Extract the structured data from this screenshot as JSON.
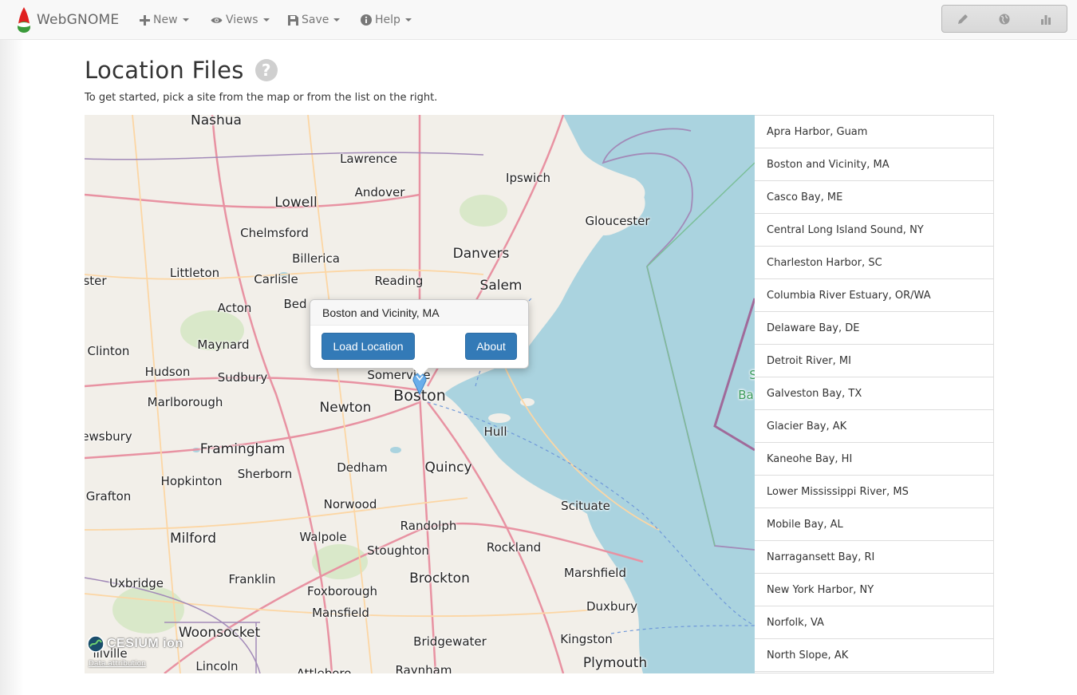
{
  "navbar": {
    "brand": "WebGNOME",
    "menus": [
      {
        "label": "New",
        "icon": "plus-icon"
      },
      {
        "label": "Views",
        "icon": "eye-icon"
      },
      {
        "label": "Save",
        "icon": "save-icon"
      },
      {
        "label": "Help",
        "icon": "info-circle-icon"
      }
    ],
    "tools": [
      "pencil-icon",
      "globe-icon",
      "bar-chart-icon"
    ]
  },
  "page": {
    "title": "Location Files",
    "intro": "To get started, pick a site from the map or from the list on the right."
  },
  "map": {
    "places": [
      "Nashua",
      "Lawrence",
      "Ipswich",
      "Andover",
      "Lowell",
      "Gloucester",
      "Chelmsford",
      "Danvers",
      "Billerica",
      "Salem",
      "Littleton",
      "Carlisle",
      "Reading",
      "ster",
      "Acton",
      "Bed",
      "Maynard",
      "Clinton",
      "Hudson",
      "Sudbury",
      "Somerville",
      "Marlborough",
      "Newton",
      "Boston",
      "Hull",
      "ewsbury",
      "Framingham",
      "Dedham",
      "Quincy",
      "Hopkinton",
      "Sherborn",
      "Grafton",
      "Norwood",
      "Scituate",
      "Milford",
      "Walpole",
      "Randolph",
      "Stoughton",
      "Rockland",
      "Franklin",
      "Uxbridge",
      "Brockton",
      "Marshfield",
      "Foxborough",
      "Mansfield",
      "Duxbury",
      "Woonsocket",
      "Bridgewater",
      "Kingston",
      "illville",
      "Lincoln",
      "Plymouth",
      "Attleboro",
      "Raynham",
      "S",
      "Ba"
    ],
    "popup": {
      "title": "Boston and Vicinity, MA",
      "load_label": "Load Location",
      "about_label": "About"
    },
    "cesium_logo": "CESIUM ion",
    "attribution": "Data attribution"
  },
  "locations": [
    "Apra Harbor, Guam",
    "Boston and Vicinity, MA",
    "Casco Bay, ME",
    "Central Long Island Sound, NY",
    "Charleston Harbor, SC",
    "Columbia River Estuary, OR/WA",
    "Delaware Bay, DE",
    "Detroit River, MI",
    "Galveston Bay, TX",
    "Glacier Bay, AK",
    "Kaneohe Bay, HI",
    "Lower Mississippi River, MS",
    "Mobile Bay, AL",
    "Narragansett Bay, RI",
    "New York Harbor, NY",
    "Norfolk, VA",
    "North Slope, AK"
  ],
  "colors": {
    "primary": "#337ab7",
    "water": "#aad3df",
    "land": "#f2efe9"
  }
}
